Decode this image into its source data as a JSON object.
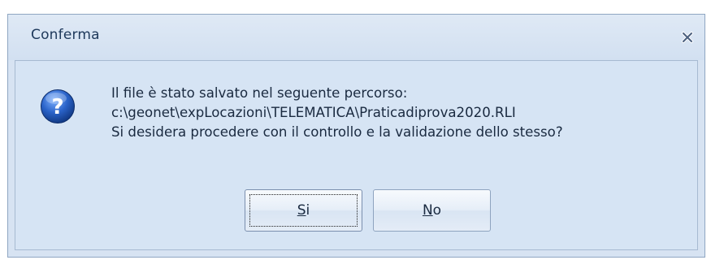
{
  "dialog": {
    "title": "Conferma",
    "close_icon": "close-icon",
    "message_icon": "question-icon",
    "message_lines": [
      "Il file è stato salvato nel seguente percorso:",
      "c:\\geonet\\expLocazioni\\TELEMATICA\\Praticadiprova2020.RLI",
      "Si desidera procedere con il controllo e la validazione dello stesso?"
    ],
    "buttons": {
      "yes": {
        "mnemonic": "S",
        "rest": "i"
      },
      "no": {
        "mnemonic": "N",
        "rest": "o"
      }
    }
  }
}
